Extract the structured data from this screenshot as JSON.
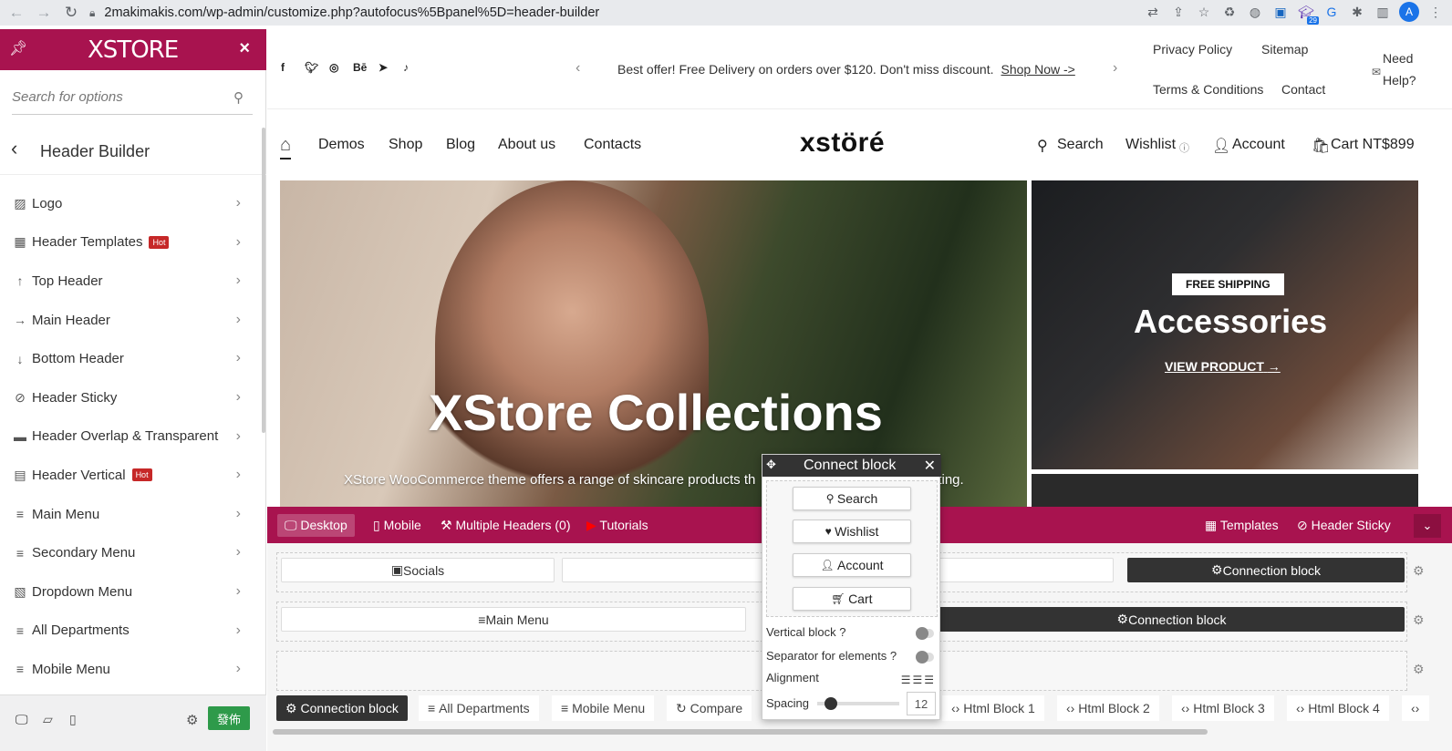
{
  "browser": {
    "url": "2makimakis.com/wp-admin/customize.php?autofocus%5Bpanel%5D=header-builder",
    "avatar": "A",
    "ext_badge": "29"
  },
  "sidebar": {
    "logo": "XSTORE",
    "search_placeholder": "Search for options",
    "title": "Header Builder",
    "items": [
      {
        "label": "Logo",
        "icon": "image-icon"
      },
      {
        "label": "Header Templates",
        "icon": "templates-icon",
        "badge": "Hot"
      },
      {
        "label": "Top Header",
        "icon": "arrow-up-icon"
      },
      {
        "label": "Main Header",
        "icon": "arrow-right-icon"
      },
      {
        "label": "Bottom Header",
        "icon": "arrow-down-icon"
      },
      {
        "label": "Header Sticky",
        "icon": "paperclip-icon"
      },
      {
        "label": "Header Overlap & Transparent",
        "icon": "overlap-icon"
      },
      {
        "label": "Header Vertical",
        "icon": "vertical-icon",
        "badge": "Hot"
      },
      {
        "label": "Main Menu",
        "icon": "menu-icon"
      },
      {
        "label": "Secondary Menu",
        "icon": "menu-icon"
      },
      {
        "label": "Dropdown Menu",
        "icon": "dropdown-icon"
      },
      {
        "label": "All Departments",
        "icon": "menu-icon"
      },
      {
        "label": "Mobile Menu",
        "icon": "menu-icon"
      }
    ],
    "publish": "發佈"
  },
  "site": {
    "promo_text": "Best offer! Free Delivery on orders over $120. Don't miss discount.",
    "promo_link": "Shop Now ->",
    "top_links": {
      "privacy": "Privacy Policy",
      "sitemap": "Sitemap",
      "terms": "Terms & Conditions",
      "contact": "Contact",
      "help1": "Need",
      "help2": "Help?"
    },
    "nav": [
      "Demos",
      "Shop",
      "Blog",
      "About us",
      "Contacts"
    ],
    "brand": "xstöré",
    "header_right": {
      "search": "Search",
      "wishlist": "Wishlist",
      "account": "Account",
      "cart": "Cart NT$899"
    },
    "hero_title": "XStore Collections",
    "hero_sub": "XStore WooCommerce theme offers a range of skincare products th",
    "hero_sub_end": "ting.",
    "banner": {
      "badge": "FREE SHIPPING",
      "title": "Accessories",
      "link": "VIEW PRODUCT"
    }
  },
  "builder": {
    "bar": {
      "desktop": "Desktop",
      "mobile": "Mobile",
      "multi": "Multiple Headers (0)",
      "tutorials": "Tutorials",
      "templates": "Templates",
      "sticky": "Header Sticky"
    },
    "row1": {
      "socials": "Socials",
      "connection": "Connection block"
    },
    "row2": {
      "main_menu": "Main Menu",
      "connection": "Connection block"
    },
    "pool": [
      "Connection block",
      "All Departments",
      "Mobile Menu",
      "Compare",
      "Html Block 1",
      "Html Block 2",
      "Html Block 3",
      "Html Block 4"
    ]
  },
  "popup": {
    "title": "Connect block",
    "items": [
      "Search",
      "Wishlist",
      "Account",
      "Cart"
    ],
    "vertical": "Vertical block ?",
    "separator": "Separator for elements ?",
    "alignment": "Alignment",
    "spacing": "Spacing",
    "spacing_value": "12"
  },
  "colors": {
    "brand": "#a8134f",
    "publish": "#2e9a4a",
    "dark": "#333333"
  }
}
